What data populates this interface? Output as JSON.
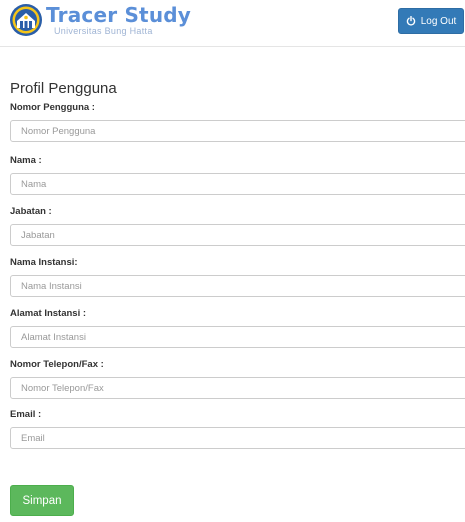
{
  "header": {
    "brand_title": "Tracer Study",
    "brand_subtitle": "Universitas Bung Hatta",
    "logo_icon": "university-seal-icon",
    "logout_label": "Log Out",
    "logout_icon": "power-icon"
  },
  "page": {
    "title": "Profil Pengguna"
  },
  "form": {
    "fields": [
      {
        "label": "Nomor Pengguna :",
        "placeholder": "Nomor Pengguna",
        "value": ""
      },
      {
        "label": "Nama :",
        "placeholder": "Nama",
        "value": ""
      },
      {
        "label": "Jabatan :",
        "placeholder": "Jabatan",
        "value": ""
      },
      {
        "label": "Nama Instansi:",
        "placeholder": "Nama Instansi",
        "value": ""
      },
      {
        "label": "Alamat Instansi :",
        "placeholder": "Alamat Instansi",
        "value": ""
      },
      {
        "label": "Nomor Telepon/Fax :",
        "placeholder": "Nomor Telepon/Fax",
        "value": ""
      },
      {
        "label": "Email :",
        "placeholder": "Email",
        "value": ""
      }
    ],
    "submit_label": "Simpan"
  },
  "colors": {
    "brand": "#5b8fd8",
    "primary_button": "#337ab7",
    "success_button": "#5cb85c"
  }
}
